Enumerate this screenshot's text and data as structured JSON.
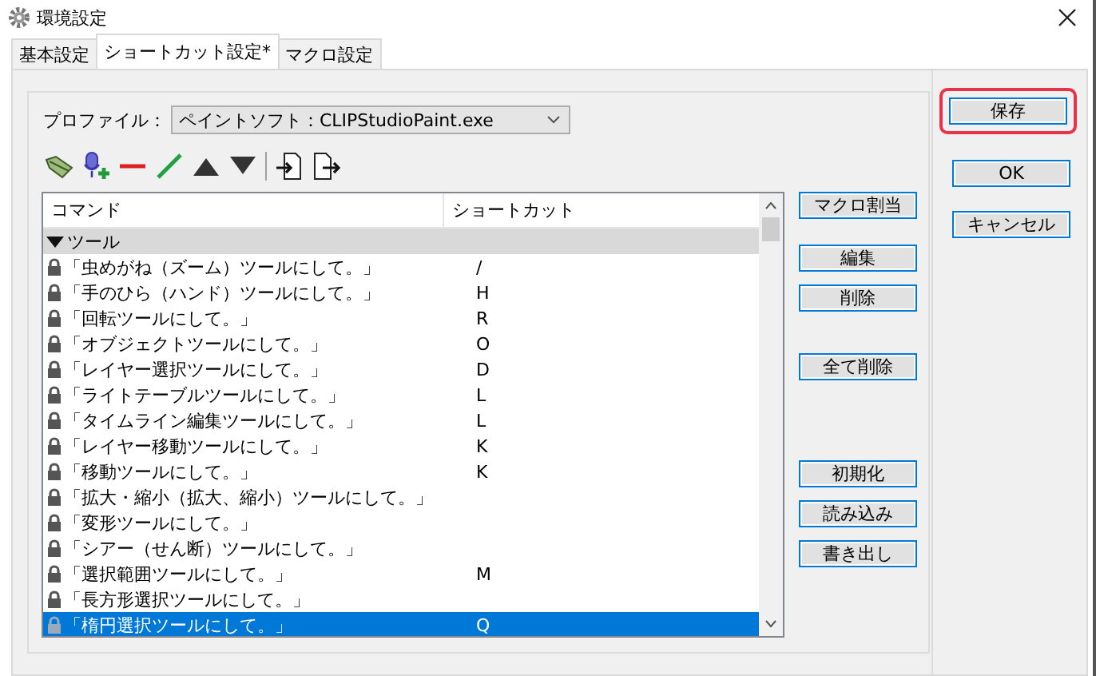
{
  "window": {
    "title": "環境設定"
  },
  "tabs": [
    {
      "label": "基本設定",
      "selected": false
    },
    {
      "label": "ショートカット設定*",
      "selected": true
    },
    {
      "label": "マクロ設定",
      "selected": false
    }
  ],
  "profile": {
    "label": "プロファイル：",
    "value": "ペイントソフト：CLIPStudioPaint.exe"
  },
  "list": {
    "columns": [
      "コマンド",
      "ショートカット"
    ],
    "groups": [
      {
        "label": "ツール",
        "expanded": true,
        "rows": [
          {
            "command": "「虫めがね（ズーム）ツールにして。」",
            "shortcut": "/",
            "selected": false
          },
          {
            "command": "「手のひら（ハンド）ツールにして。」",
            "shortcut": "H",
            "selected": false
          },
          {
            "command": "「回転ツールにして。」",
            "shortcut": "R",
            "selected": false
          },
          {
            "command": "「オブジェクトツールにして。」",
            "shortcut": "O",
            "selected": false
          },
          {
            "command": "「レイヤー選択ツールにして。」",
            "shortcut": "D",
            "selected": false
          },
          {
            "command": "「ライトテーブルツールにして。」",
            "shortcut": "L",
            "selected": false
          },
          {
            "command": "「タイムライン編集ツールにして。」",
            "shortcut": "L",
            "selected": false
          },
          {
            "command": "「レイヤー移動ツールにして。」",
            "shortcut": "K",
            "selected": false
          },
          {
            "command": "「移動ツールにして。」",
            "shortcut": "K",
            "selected": false
          },
          {
            "command": "「拡大・縮小（拡大、縮小）ツールにして。」",
            "shortcut": "",
            "selected": false
          },
          {
            "command": "「変形ツールにして。」",
            "shortcut": "",
            "selected": false
          },
          {
            "command": "「シアー（せん断）ツールにして。」",
            "shortcut": "",
            "selected": false
          },
          {
            "command": "「選択範囲ツールにして。」",
            "shortcut": "M",
            "selected": false
          },
          {
            "command": "「長方形選択ツールにして。」",
            "shortcut": "",
            "selected": false
          },
          {
            "command": "「楕円選択ツールにして。」",
            "shortcut": "Q",
            "selected": true
          }
        ]
      }
    ]
  },
  "side_buttons": [
    [
      "マクロ割当"
    ],
    [
      "編集",
      "削除"
    ],
    [
      "全て削除"
    ],
    [
      "初期化",
      "読み込み",
      "書き出し"
    ]
  ],
  "dialog_buttons": [
    {
      "label": "保存",
      "highlighted": true
    },
    {
      "label": "OK",
      "highlighted": false
    },
    {
      "label": "キャンセル",
      "highlighted": false
    }
  ]
}
